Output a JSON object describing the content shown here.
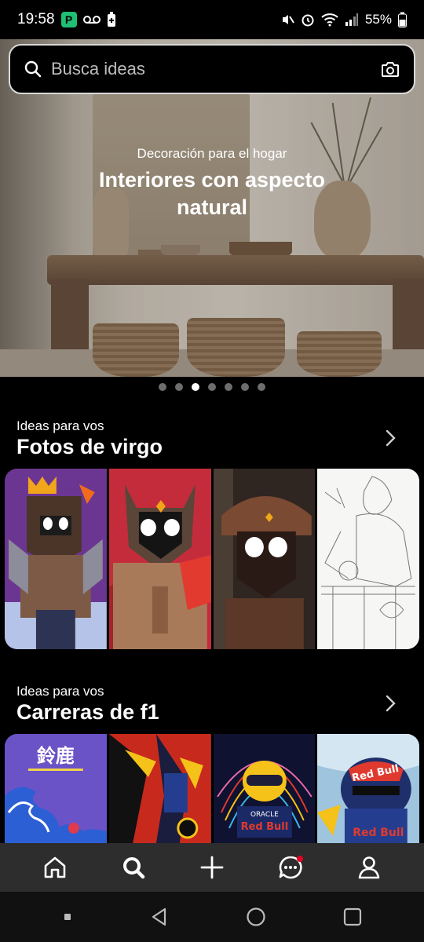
{
  "status_bar": {
    "time": "19:58",
    "battery": "55%",
    "icons": [
      "app-p-icon",
      "voicemail-icon",
      "battery-saver-icon",
      "mute-icon",
      "alarm-icon",
      "wifi-icon",
      "signal-icon",
      "battery-icon"
    ]
  },
  "search": {
    "placeholder": "Busca ideas",
    "left_icon": "search-icon",
    "right_icon": "camera-icon"
  },
  "hero": {
    "subtitle": "Decoración para el hogar",
    "title": "Interiores con aspecto natural",
    "carousel_total": 7,
    "carousel_active_index": 2
  },
  "sections": [
    {
      "kicker": "Ideas para vos",
      "title": "Fotos de virgo",
      "chevron_icon": "chevron-right-icon"
    },
    {
      "kicker": "Ideas para vos",
      "title": "Carreras de f1",
      "chevron_icon": "chevron-right-icon"
    }
  ],
  "bottom_nav": {
    "items": [
      "home-icon",
      "search-icon",
      "plus-icon",
      "messages-icon",
      "profile-icon"
    ],
    "active": "search-icon",
    "notification_badge_on": "messages-icon"
  },
  "system_nav": {
    "items": [
      "menu-dot-icon",
      "back-icon",
      "home-circle-icon",
      "recents-icon"
    ]
  },
  "colors": {
    "background": "#000000",
    "nav_bar": "#2d2d2d",
    "badge": "#e60023",
    "dot_inactive": "#6d6d6d",
    "dot_active": "#ffffff"
  },
  "f1_poster_text": {
    "kanji": "鈴鹿",
    "team": "Red Bull",
    "sponsor": "ORACLE"
  }
}
